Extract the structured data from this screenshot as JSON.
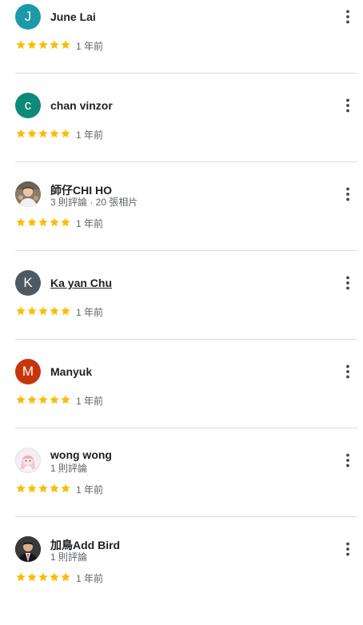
{
  "colors": {
    "star": "#fbbc04",
    "divider": "#dadce0",
    "secondary_text": "#5f6368"
  },
  "reviews": [
    {
      "name": "June Lai",
      "initial": "J",
      "avatar_color": "#1a9aa8",
      "avatar_type": "letter",
      "subtitle": "",
      "rating": 5,
      "time": "1 年前"
    },
    {
      "name": "chan vinzor",
      "initial": "c",
      "avatar_color": "#0d8a7a",
      "avatar_type": "letter",
      "subtitle": "",
      "rating": 5,
      "time": "1 年前"
    },
    {
      "name": "師仔CHI HO",
      "initial": "",
      "avatar_color": "#7a6a5a",
      "avatar_type": "photo",
      "subtitle": "3 則評論 · 20 張相片",
      "rating": 5,
      "time": "1 年前"
    },
    {
      "name": "Ka yan Chu",
      "initial": "K",
      "avatar_color": "#4d5a63",
      "avatar_type": "letter",
      "subtitle": "",
      "rating": 5,
      "time": "1 年前"
    },
    {
      "name": "Manyuk",
      "initial": "M",
      "avatar_color": "#c7360b",
      "avatar_type": "letter",
      "subtitle": "",
      "rating": 5,
      "time": "1 年前"
    },
    {
      "name": "wong wong",
      "initial": "",
      "avatar_color": "#f4e6ec",
      "avatar_type": "photo",
      "subtitle": "1 則評論",
      "rating": 5,
      "time": "1 年前"
    },
    {
      "name": "加鳥Add Bird",
      "initial": "",
      "avatar_color": "#2a2a2a",
      "avatar_type": "photo",
      "subtitle": "1 則評論",
      "rating": 5,
      "time": "1 年前"
    }
  ]
}
